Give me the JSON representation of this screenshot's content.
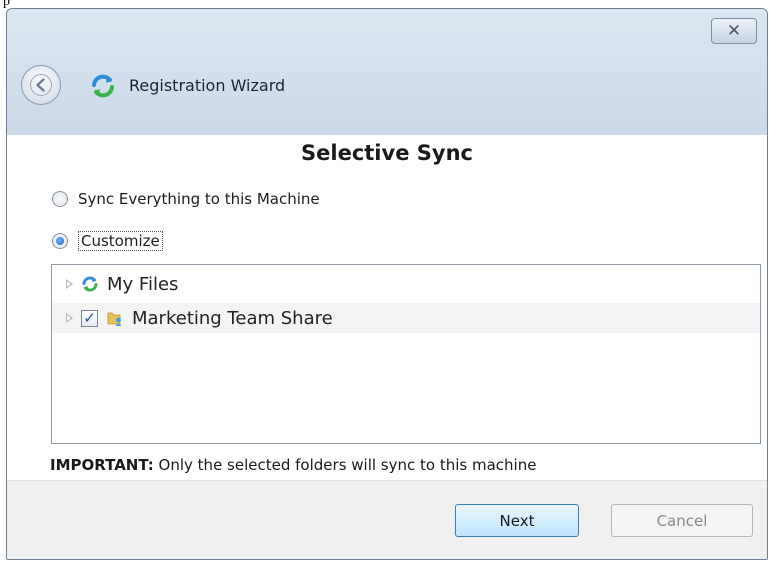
{
  "page_tag": "p",
  "window": {
    "title": "Registration Wizard",
    "close_symbol": "✕",
    "back_icon": "back-arrow-icon",
    "app_icon": "sync-icon"
  },
  "content": {
    "heading": "Selective Sync",
    "options": [
      {
        "label": "Sync Everything to this Machine",
        "selected": false
      },
      {
        "label": "Customize",
        "selected": true
      }
    ],
    "tree": [
      {
        "label": "My Files",
        "icon": "sync-icon",
        "has_checkbox": false,
        "checked": false
      },
      {
        "label": "Marketing Team Share",
        "icon": "shared-folder-icon",
        "has_checkbox": true,
        "checked": true
      }
    ],
    "important_prefix": "IMPORTANT:",
    "important_text": " Only the selected folders will sync to this machine"
  },
  "footer": {
    "next_label": "Next",
    "cancel_label": "Cancel"
  },
  "colors": {
    "titlebar": "#d8e3ef",
    "accent_blue": "#3c7fb1",
    "sync_green": "#38b449"
  }
}
